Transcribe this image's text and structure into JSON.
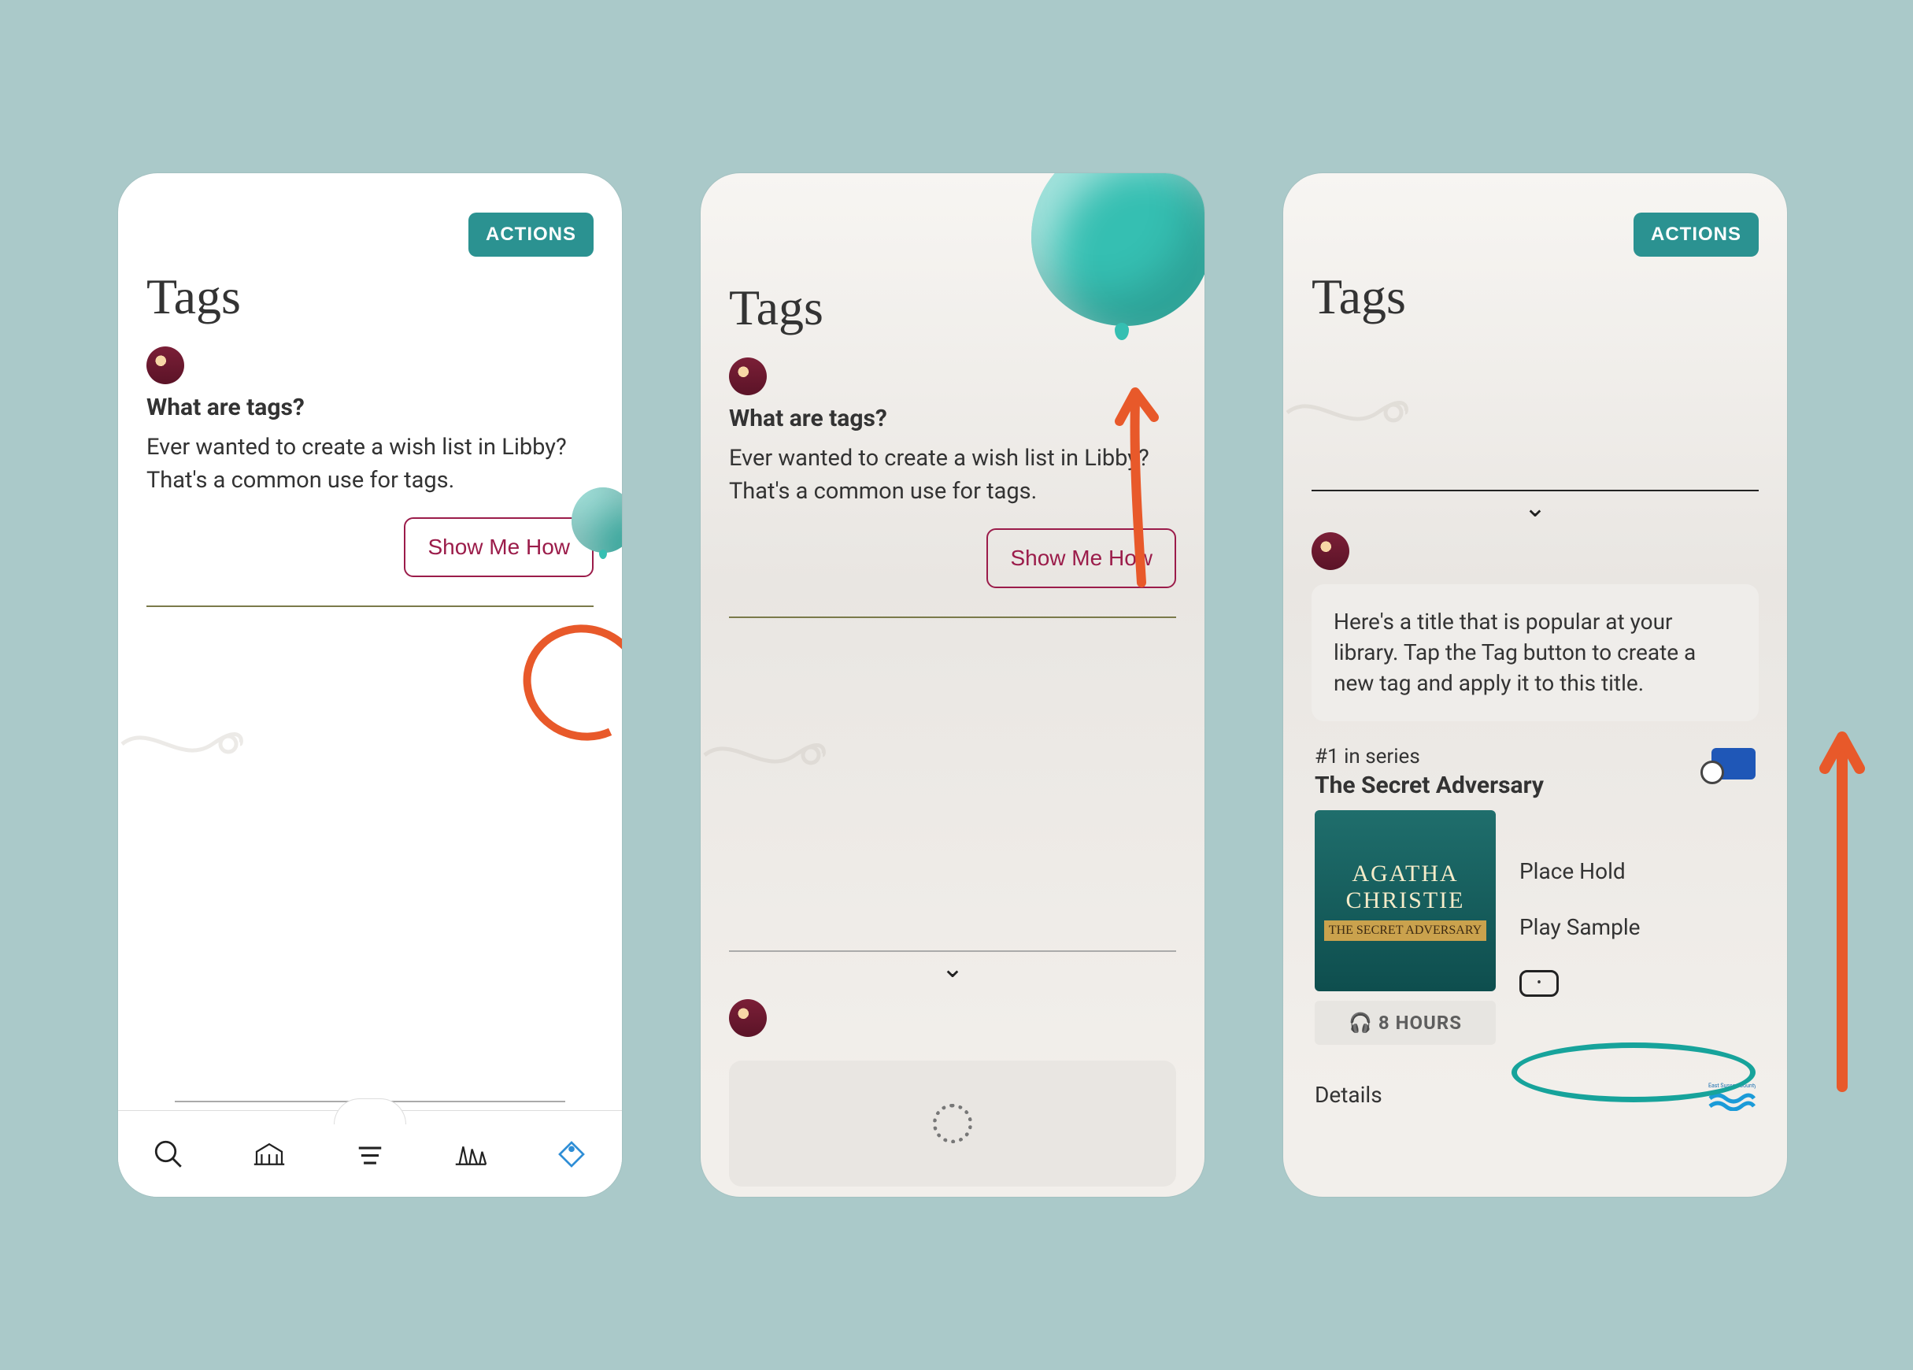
{
  "common": {
    "actions_label": "ACTIONS",
    "page_title": "Tags",
    "question": "What are tags?",
    "body": "Ever wanted to create a wish list in Libby? That's a common use for tags.",
    "show_me_how": "Show Me How"
  },
  "panel3": {
    "tip": "Here's a title that is popular at your library. Tap the Tag button to create a new tag and apply it to this title.",
    "series_label": "#1 in series",
    "book_title": "The Secret Adversary",
    "cover_author": "AGATHA CHRISTIE",
    "cover_subtitle": "THE SECRET ADVERSARY",
    "actions": {
      "place_hold": "Place Hold",
      "play_sample": "Play Sample",
      "details": "Details"
    },
    "hours_badge": "8 HOURS",
    "library_name": "East Sussex County Council"
  },
  "colors": {
    "balloon": "#35bfb2"
  }
}
